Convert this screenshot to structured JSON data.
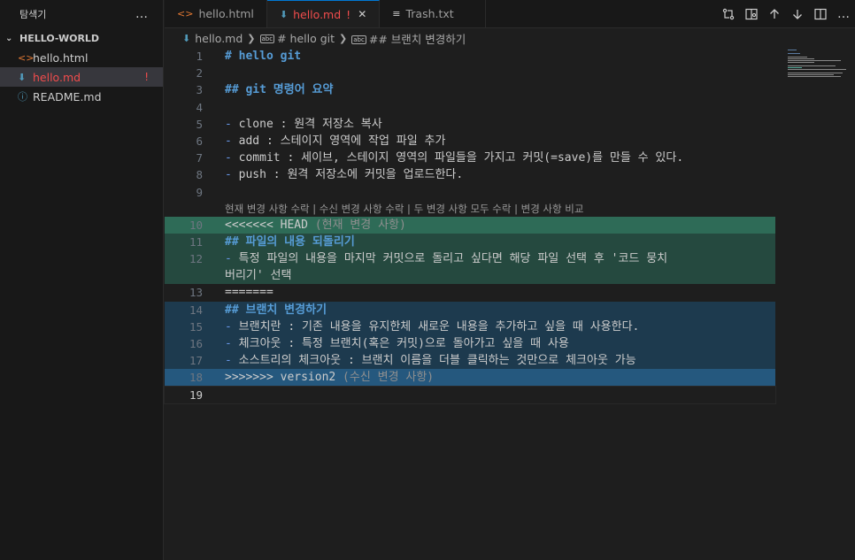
{
  "sidebar": {
    "title": "탐색기",
    "more_icon": "…",
    "folder": "HELLO-WORLD",
    "files": [
      {
        "name": "hello.html",
        "icon": "html-icon",
        "glyph": "<>",
        "color": "#e37933"
      },
      {
        "name": "hello.md",
        "icon": "markdown-icon",
        "glyph": "⬇",
        "color": "#519aba",
        "active": true,
        "badge": "!"
      },
      {
        "name": "README.md",
        "icon": "info-icon",
        "glyph": "ⓘ",
        "color": "#519aba"
      }
    ]
  },
  "tabs": [
    {
      "label": "hello.html",
      "glyph": "<>",
      "color": "#e37933"
    },
    {
      "label": "hello.md",
      "glyph": "⬇",
      "color": "#519aba",
      "active": true,
      "mod": "!",
      "close": "✕"
    },
    {
      "label": "Trash.txt",
      "glyph": "≡",
      "color": "#cccccc"
    }
  ],
  "breadcrumb": [
    "hello.md",
    "# hello git",
    "## 브랜치 변경하기"
  ],
  "codelens": "현재 변경 사항 수락 | 수신 변경 사항 수락 | 두 변경 사항 모두 수락 | 변경 사항 비교",
  "lines": {
    "l1": "# hello git",
    "l3": "## git 명령어 요약",
    "l5a": "clone",
    "l5b": " : 원격 저장소 복사",
    "l6a": "add",
    "l6b": " : 스테이지 영역에 작업 파일 추가",
    "l7a": "commit",
    "l7b": " : 세이브, 스테이지 영역의 파일들을 가지고 커밋(=save)를 만들 수 있다.",
    "l8a": "push",
    "l8b": " : 원격 저장소에 커밋을 업로드한다.",
    "l10a": "<<<<<<< HEAD",
    "l10b": " (현재 변경 사항)",
    "l11": "## 파일의 내용 되돌리기",
    "l12a": " 특정 파일의 내용을 마지막 커밋으로 돌리고 싶다면 해당 파일 선택 후 '코드 뭉치",
    "l12b": "버리기' 선택",
    "l13": "=======",
    "l14": "## 브랜치 변경하기",
    "l15": " 브랜치란 : 기존 내용을 유지한체 새로운 내용을 추가하고 싶을 때 사용한다.",
    "l16": " 체크아웃 : 특정 브랜치(혹은 커밋)으로 돌아가고 싶을 때 사용",
    "l17": " 소스트리의 체크아웃 : 브랜치 이름을 더블 클릭하는 것만으로 체크아웃 가능",
    "l18a": ">>>>>>> version2",
    "l18b": " (수신 변경 사항)",
    "bullet": "-"
  },
  "line_numbers": [
    "1",
    "2",
    "3",
    "4",
    "5",
    "6",
    "7",
    "8",
    "9",
    "10",
    "11",
    "12",
    "13",
    "14",
    "15",
    "16",
    "17",
    "18",
    "19"
  ]
}
